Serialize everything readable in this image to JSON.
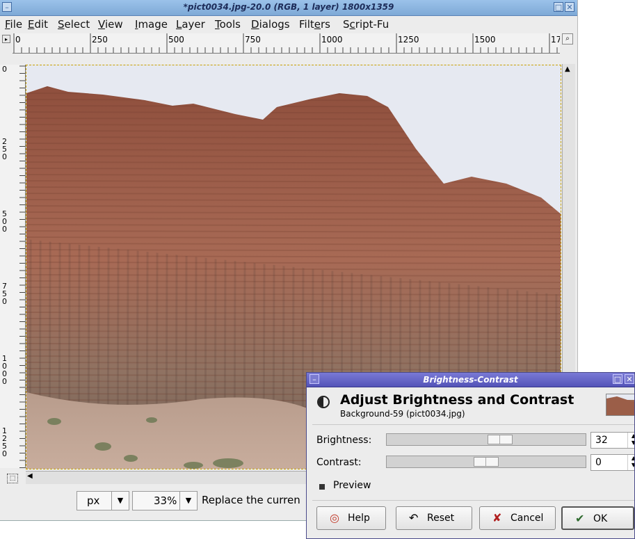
{
  "image_window": {
    "title": "*pict0034.jpg-20.0 (RGB, 1 layer) 1800x1359",
    "menu": [
      "File",
      "Edit",
      "Select",
      "View",
      "Image",
      "Layer",
      "Tools",
      "Dialogs",
      "Filters",
      "Script-Fu"
    ],
    "menu_mnemonic_index": [
      0,
      0,
      0,
      0,
      0,
      0,
      0,
      0,
      4,
      1
    ],
    "ruler_h_labels": [
      "0",
      "250",
      "500",
      "750",
      "1000",
      "1250",
      "1500",
      "17"
    ],
    "ruler_v_labels": [
      "0",
      "250",
      "500",
      "750",
      "1000",
      "1250"
    ],
    "unit": "px",
    "zoom": "33%",
    "status_text": "Replace the curren"
  },
  "dialog": {
    "title": "Brightness-Contrast",
    "heading": "Adjust Brightness and Contrast",
    "subheading": "Background-59 (pict0034.jpg)",
    "brightness_label": "Brightness:",
    "brightness_value": "32",
    "brightness_fraction": 0.58,
    "contrast_label": "Contrast:",
    "contrast_value": "0",
    "contrast_fraction": 0.5,
    "preview_label": "Preview",
    "preview_checked": true,
    "buttons": {
      "help": "Help",
      "reset": "Reset",
      "cancel": "Cancel",
      "ok": "OK"
    }
  },
  "colors": {
    "title_gradient": "#8db4e0",
    "dialog_title": "#5a5ac0",
    "rock": "#a4614b",
    "sky": "#e6e9f1"
  }
}
